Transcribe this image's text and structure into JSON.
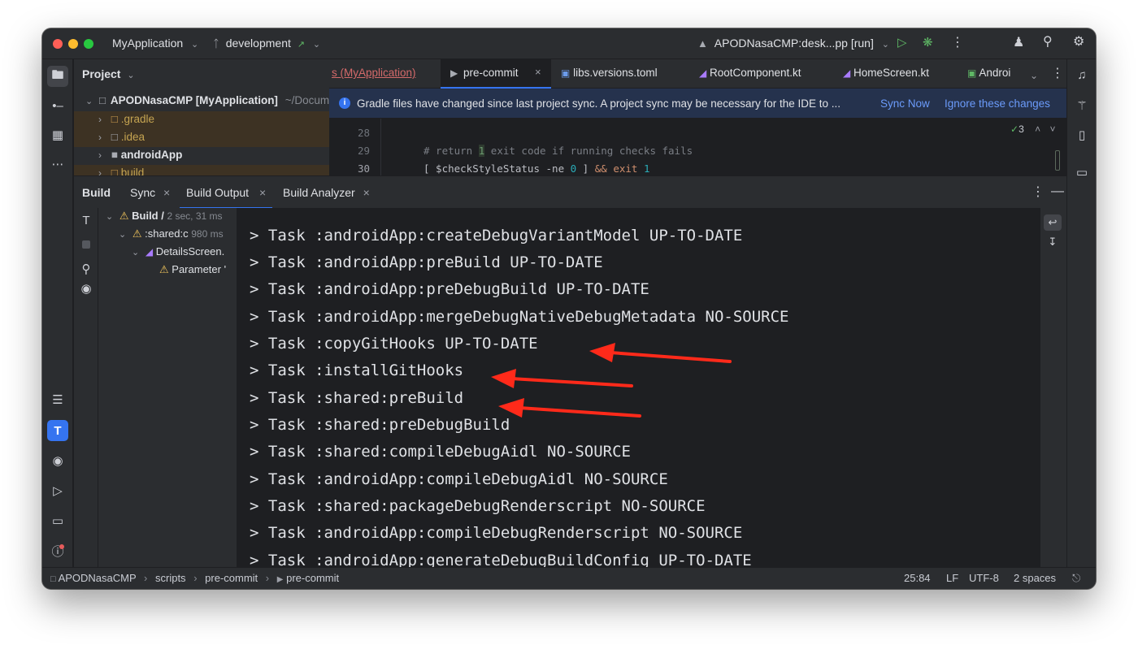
{
  "titlebar": {
    "project_name": "MyApplication",
    "branch": "development",
    "run_config": "APODNasaCMP:desk...pp [run]"
  },
  "project_panel": {
    "title": "Project",
    "root": "APODNasaCMP [MyApplication]",
    "root_path": "~/Docum",
    "items": [
      {
        "label": ".gradle"
      },
      {
        "label": ".idea"
      },
      {
        "label": "androidApp"
      },
      {
        "label": "build"
      }
    ]
  },
  "editor_tabs": [
    {
      "label": "s (MyApplication)"
    },
    {
      "label": "pre-commit"
    },
    {
      "label": "libs.versions.toml"
    },
    {
      "label": "RootComponent.kt"
    },
    {
      "label": "HomeScreen.kt"
    },
    {
      "label": "Androi"
    }
  ],
  "banner": {
    "message": "Gradle files have changed since last project sync. A project sync may be necessary for the IDE to ...",
    "sync_now": "Sync Now",
    "ignore": "Ignore these changes"
  },
  "editor": {
    "inspection_count": "3",
    "lines": [
      {
        "num": "28",
        "text": ""
      },
      {
        "num": "29",
        "comment": "# return ",
        "num_token": "1",
        "rest": " exit code if running checks fails"
      },
      {
        "num": "30",
        "p1": "[ $checkStyleStatus -ne ",
        "zero": "0",
        "p2": " ] ",
        "amp": "&&",
        "p3": " ",
        "kw": "exit",
        "p4": " ",
        "one": "1"
      }
    ]
  },
  "build_panel": {
    "tabs": [
      {
        "label": "Build"
      },
      {
        "label": "Sync"
      },
      {
        "label": "Build Output"
      },
      {
        "label": "Build Analyzer"
      }
    ],
    "tree": [
      {
        "label": "Build /",
        "time": "2 sec, 31 ms"
      },
      {
        "label": ":shared:c",
        "time": "980 ms"
      },
      {
        "label": "DetailsScreen."
      },
      {
        "label": "Parameter '"
      }
    ],
    "console_lines": [
      "> Task :androidApp:createDebugVariantModel UP-TO-DATE",
      "> Task :androidApp:preBuild UP-TO-DATE",
      "> Task :androidApp:preDebugBuild UP-TO-DATE",
      "> Task :androidApp:mergeDebugNativeDebugMetadata NO-SOURCE",
      "> Task :copyGitHooks UP-TO-DATE",
      "> Task :installGitHooks",
      "> Task :shared:preBuild",
      "> Task :shared:preDebugBuild",
      "> Task :shared:compileDebugAidl NO-SOURCE",
      "> Task :androidApp:compileDebugAidl NO-SOURCE",
      "> Task :shared:packageDebugRenderscript NO-SOURCE",
      "> Task :androidApp:compileDebugRenderscript NO-SOURCE",
      "> Task :androidApp:generateDebugBuildConfig UP-TO-DATE"
    ]
  },
  "statusbar": {
    "breadcrumb": [
      "APODNasaCMP",
      "scripts",
      "pre-commit",
      "pre-commit"
    ],
    "position": "25:84",
    "line_sep": "LF",
    "encoding": "UTF-8",
    "indent": "2 spaces"
  },
  "colors": {
    "accent": "#3574f0",
    "annotation_arrow": "#ff2a1a",
    "link": "#548af7",
    "warning": "#f2c55c"
  }
}
